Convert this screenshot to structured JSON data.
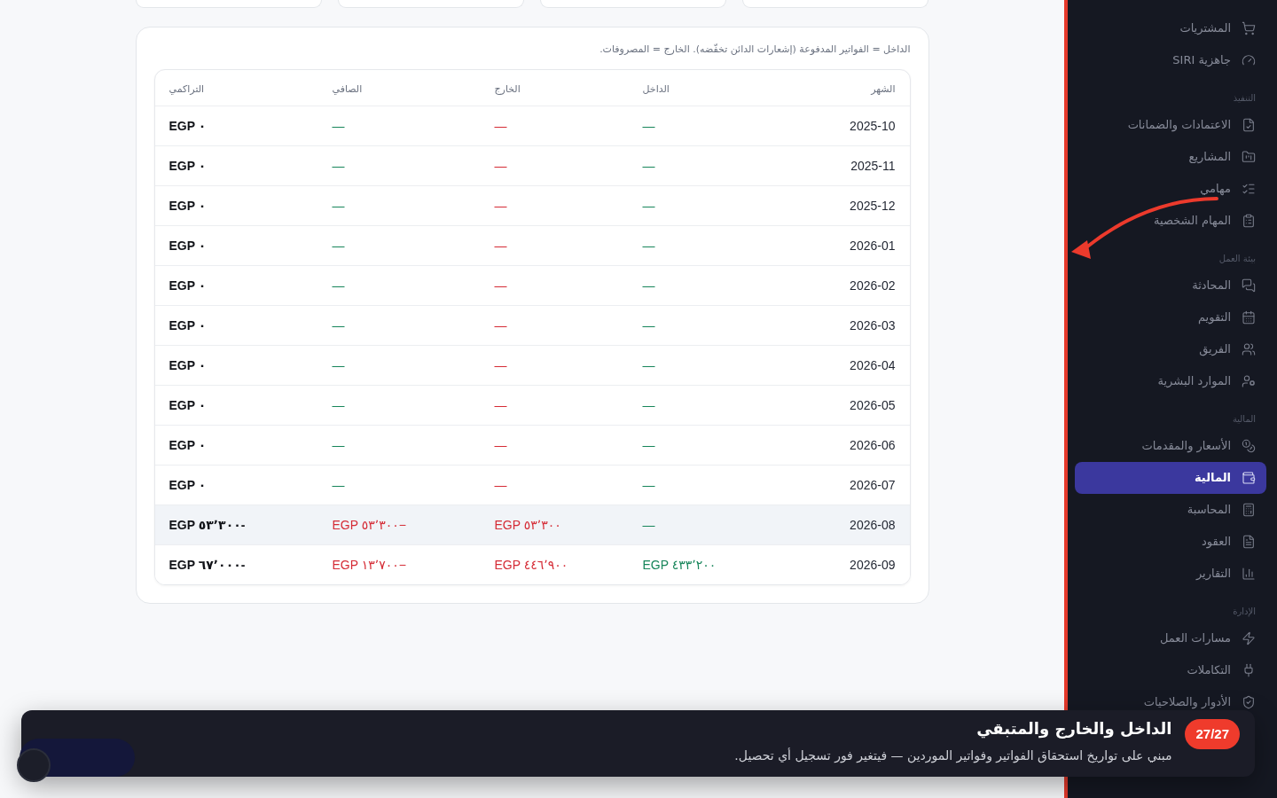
{
  "cashflow": {
    "note": "الداخل = الفواتير المدفوعة (إشعارات الدائن تخفّضه). الخارج = المصروفات.",
    "columns": [
      "الشهر",
      "الداخل",
      "الخارج",
      "الصافي",
      "التراكمي"
    ],
    "rows": [
      {
        "month": "2025-10",
        "inflow": "—",
        "outflow": "—",
        "net": "—",
        "net_negative": false,
        "cumulative": "EGP ٠",
        "highlighted": false
      },
      {
        "month": "2025-11",
        "inflow": "—",
        "outflow": "—",
        "net": "—",
        "net_negative": false,
        "cumulative": "EGP ٠",
        "highlighted": false
      },
      {
        "month": "2025-12",
        "inflow": "—",
        "outflow": "—",
        "net": "—",
        "net_negative": false,
        "cumulative": "EGP ٠",
        "highlighted": false
      },
      {
        "month": "2026-01",
        "inflow": "—",
        "outflow": "—",
        "net": "—",
        "net_negative": false,
        "cumulative": "EGP ٠",
        "highlighted": false
      },
      {
        "month": "2026-02",
        "inflow": "—",
        "outflow": "—",
        "net": "—",
        "net_negative": false,
        "cumulative": "EGP ٠",
        "highlighted": false
      },
      {
        "month": "2026-03",
        "inflow": "—",
        "outflow": "—",
        "net": "—",
        "net_negative": false,
        "cumulative": "EGP ٠",
        "highlighted": false
      },
      {
        "month": "2026-04",
        "inflow": "—",
        "outflow": "—",
        "net": "—",
        "net_negative": false,
        "cumulative": "EGP ٠",
        "highlighted": false
      },
      {
        "month": "2026-05",
        "inflow": "—",
        "outflow": "—",
        "net": "—",
        "net_negative": false,
        "cumulative": "EGP ٠",
        "highlighted": false
      },
      {
        "month": "2026-06",
        "inflow": "—",
        "outflow": "—",
        "net": "—",
        "net_negative": false,
        "cumulative": "EGP ٠",
        "highlighted": false
      },
      {
        "month": "2026-07",
        "inflow": "—",
        "outflow": "—",
        "net": "—",
        "net_negative": false,
        "cumulative": "EGP ٠",
        "highlighted": false
      },
      {
        "month": "2026-08",
        "inflow": "—",
        "outflow": "EGP ٥٣٬٣٠٠",
        "net": "EGP ٥٣٬٣٠٠−",
        "net_negative": true,
        "cumulative": "EGP ٥٣٬٣٠٠-",
        "highlighted": true
      },
      {
        "month": "2026-09",
        "inflow": "EGP ٤٣٣٬٢٠٠",
        "outflow": "EGP ٤٤٦٬٩٠٠",
        "net": "EGP ١٣٬٧٠٠−",
        "net_negative": true,
        "cumulative": "EGP ٦٧٬٠٠٠-",
        "highlighted": false
      }
    ]
  },
  "sidebar": {
    "sections": [
      {
        "items": [
          {
            "label": "المشتريات",
            "selected": false
          },
          {
            "label": "جاهزية SIRI",
            "selected": false
          }
        ]
      },
      {
        "title": "التنفيذ",
        "items": [
          {
            "label": "الاعتمادات والضمانات",
            "selected": false
          },
          {
            "label": "المشاريع",
            "selected": false
          },
          {
            "label": "مهامي",
            "selected": false
          },
          {
            "label": "المهام الشخصية",
            "selected": false
          }
        ]
      },
      {
        "title": "بيئة العمل",
        "items": [
          {
            "label": "المحادثة",
            "selected": false
          },
          {
            "label": "التقويم",
            "selected": false
          },
          {
            "label": "الفريق",
            "selected": false
          },
          {
            "label": "الموارد البشرية",
            "selected": false
          }
        ]
      },
      {
        "title": "المالية",
        "items": [
          {
            "label": "الأسعار والمقدمات",
            "selected": false
          },
          {
            "label": "المالية",
            "selected": true
          },
          {
            "label": "المحاسبة",
            "selected": false
          },
          {
            "label": "العقود",
            "selected": false
          },
          {
            "label": "التقارير",
            "selected": false
          }
        ]
      },
      {
        "title": "الإدارة",
        "items": [
          {
            "label": "مسارات العمل",
            "selected": false
          },
          {
            "label": "التكاملات",
            "selected": false
          },
          {
            "label": "الأدوار والصلاحيات",
            "selected": false
          }
        ]
      }
    ]
  },
  "tour": {
    "step": "27/27",
    "title": "الداخل والخارج والمتبقي",
    "text": "مبني على تواريخ استحقاق الفواتير وفواتير الموردين — فيتغير فور تسجيل أي تحصيل."
  }
}
